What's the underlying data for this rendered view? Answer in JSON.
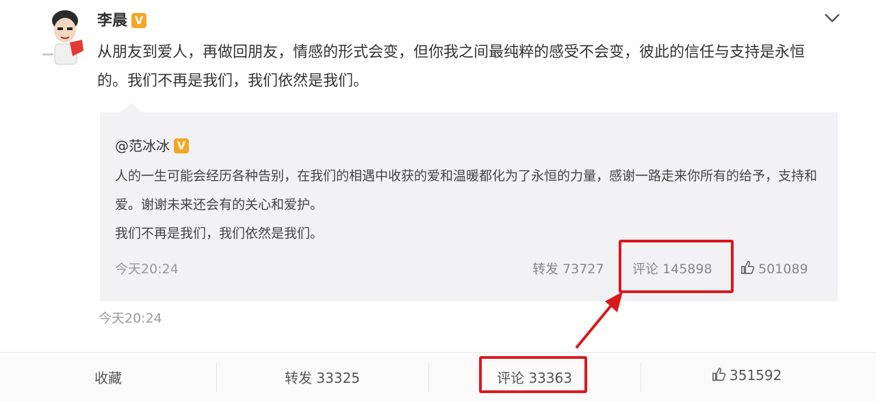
{
  "post": {
    "author": "李晨",
    "verified_badge": "V",
    "text": "从朋友到爱人，再做回朋友，情感的形式会变，但你我之间最纯粹的感受不会变，彼此的信任与支持是永恒的。我们不再是我们，我们依然是我们。",
    "time": "今天20:24"
  },
  "quoted": {
    "author": "@范冰冰",
    "verified_badge": "V",
    "text_line1": "人的一生可能会经历各种告别，在我们的相遇中收获的爱和温暖都化为了永恒的力量，感谢一路走来你所有的给予，支持和爱。谢谢未来还会有的关心和爱护。",
    "text_line2": "我们不再是我们，我们依然是我们。",
    "time": "今天20:24",
    "forward": "转发 73727",
    "comment": "评论 145898",
    "like": "501089"
  },
  "footer": {
    "favorite": "收藏",
    "forward": "转发 33325",
    "comment": "评论 33363",
    "like": "351592"
  },
  "colors": {
    "highlight": "#d9191c",
    "badge": "#f5a623"
  }
}
